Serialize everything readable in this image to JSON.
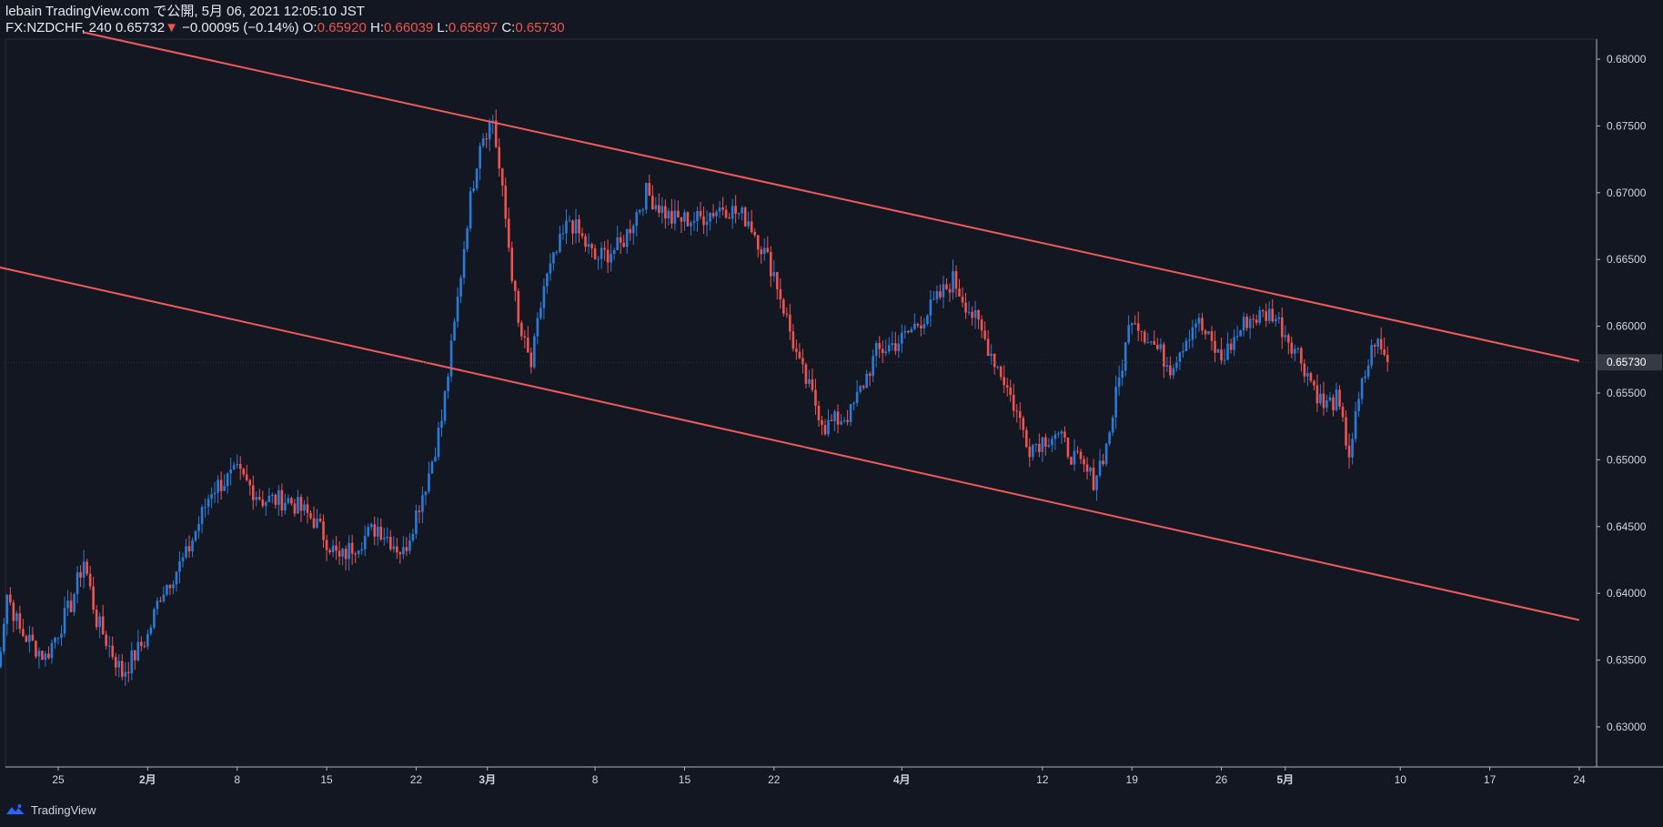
{
  "header": {
    "line1": "lebain TradingView.com で公開, 5月 06, 2021 12:05:10 JST",
    "symbol": "FX:NZDCHF, 240",
    "last": "0.65732",
    "arrow": "▼",
    "change": "−0.00095 (−0.14%)",
    "o_label": "O:",
    "o": "0.65920",
    "h_label": "H:",
    "h": "0.66039",
    "l_label": "L:",
    "l": "0.65697",
    "c_label": "C:",
    "c": "0.65730"
  },
  "footer": {
    "brand": "TradingView"
  },
  "colors": {
    "background": "#131722",
    "up": "#2962ff",
    "up_body": "#2b7bd6",
    "down": "#ef5350",
    "trendline": "#f05a5a",
    "text": "#d1d4dc",
    "price_badge_bg": "#363a45"
  },
  "chart_data": {
    "type": "candlestick",
    "symbol": "FX:NZDCHF",
    "timeframe": "240",
    "ylim": [
      0.627,
      0.6815
    ],
    "y_ticks": [
      "0.68000",
      "0.67500",
      "0.67000",
      "0.66500",
      "0.66000",
      "0.65500",
      "0.65000",
      "0.64500",
      "0.64000",
      "0.63500",
      "0.63000"
    ],
    "x_ticks": [
      "25",
      "2月",
      "8",
      "15",
      "22",
      "3月",
      "8",
      "15",
      "22",
      "4月",
      "12",
      "19",
      "26",
      "5月",
      "10",
      "17",
      "24"
    ],
    "last_price_label": "0.65730",
    "last_price": 0.6573,
    "close_path": [
      [
        "01-20",
        0.6325
      ],
      [
        "01-21",
        0.64
      ],
      [
        "01-22",
        0.6372
      ],
      [
        "01-24",
        0.6352
      ],
      [
        "01-26",
        0.6392
      ],
      [
        "01-27",
        0.6425
      ],
      [
        "01-28",
        0.638
      ],
      [
        "01-30",
        0.634
      ],
      [
        "02-01",
        0.6368
      ],
      [
        "02-02",
        0.64
      ],
      [
        "02-04",
        0.6428
      ],
      [
        "02-06",
        0.6478
      ],
      [
        "02-08",
        0.649
      ],
      [
        "02-10",
        0.647
      ],
      [
        "02-12",
        0.647
      ],
      [
        "02-14",
        0.6455
      ],
      [
        "02-16",
        0.6425
      ],
      [
        "02-17",
        0.6435
      ],
      [
        "02-19",
        0.645
      ],
      [
        "02-21",
        0.643
      ],
      [
        "02-23",
        0.649
      ],
      [
        "02-24",
        0.653
      ],
      [
        "02-25",
        0.66
      ],
      [
        "02-26",
        0.668
      ],
      [
        "02-27",
        0.674
      ],
      [
        "02-28",
        0.6755
      ],
      [
        "03-01",
        0.668
      ],
      [
        "03-02",
        0.66
      ],
      [
        "03-03",
        0.657
      ],
      [
        "03-04",
        0.663
      ],
      [
        "03-05",
        0.6655
      ],
      [
        "03-06",
        0.668
      ],
      [
        "03-08",
        0.665
      ],
      [
        "03-10",
        0.666
      ],
      [
        "03-12",
        0.67
      ],
      [
        "03-14",
        0.668
      ],
      [
        "03-16",
        0.668
      ],
      [
        "03-18",
        0.669
      ],
      [
        "03-20",
        0.668
      ],
      [
        "03-22",
        0.664
      ],
      [
        "03-24",
        0.657
      ],
      [
        "03-26",
        0.6525
      ],
      [
        "03-28",
        0.6535
      ],
      [
        "03-30",
        0.658
      ],
      [
        "04-01",
        0.659
      ],
      [
        "04-03",
        0.661
      ],
      [
        "04-05",
        0.6635
      ],
      [
        "04-07",
        0.66
      ],
      [
        "04-09",
        0.656
      ],
      [
        "04-11",
        0.651
      ],
      [
        "04-13",
        0.652
      ],
      [
        "04-15",
        0.6495
      ],
      [
        "04-16",
        0.6485
      ],
      [
        "04-17",
        0.651
      ],
      [
        "04-18",
        0.656
      ],
      [
        "04-19",
        0.661
      ],
      [
        "04-20",
        0.6595
      ],
      [
        "04-22",
        0.657
      ],
      [
        "04-24",
        0.6605
      ],
      [
        "04-26",
        0.6575
      ],
      [
        "04-28",
        0.6605
      ],
      [
        "04-30",
        0.661
      ],
      [
        "05-02",
        0.658
      ],
      [
        "05-04",
        0.654
      ],
      [
        "05-05",
        0.6545
      ],
      [
        "05-06",
        0.6505
      ],
      [
        "05-07",
        0.6555
      ],
      [
        "05-08",
        0.659
      ],
      [
        "05-09",
        0.6573
      ]
    ],
    "trendlines": [
      {
        "from": [
          "01-27",
          0.682
        ],
        "to": [
          "05-24",
          0.6574
        ]
      },
      {
        "from": [
          "01-20",
          0.6645
        ],
        "to": [
          "05-24",
          0.638
        ]
      }
    ]
  }
}
